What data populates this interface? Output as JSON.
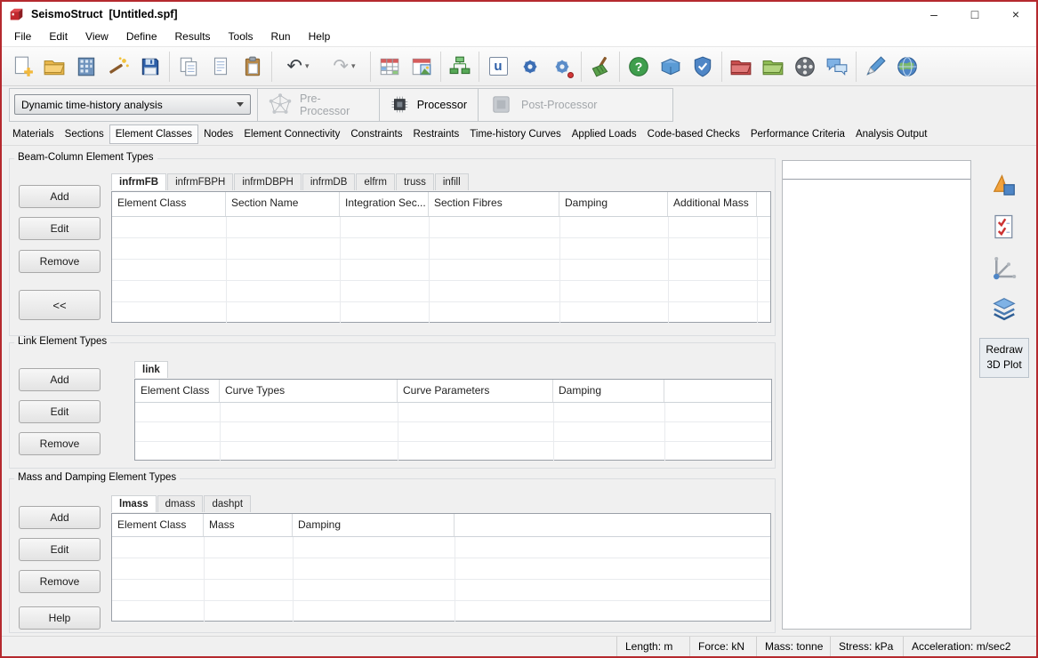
{
  "colors": {
    "brand_red": "#b5292e",
    "panel_gray": "#f0f0f0"
  },
  "window": {
    "title": "SeismoStruct  [Untitled.spf]",
    "controls": {
      "minimize": "–",
      "maximize": "□",
      "close": "×"
    }
  },
  "menubar": {
    "items": [
      "File",
      "Edit",
      "View",
      "Define",
      "Results",
      "Tools",
      "Run",
      "Help"
    ]
  },
  "toolbar": {
    "units_label": "u",
    "glyphs": {
      "undo": "↶",
      "redo": "↷",
      "dropdown": "▾",
      "help_q": "?"
    },
    "icons": [
      "new-project",
      "open-project",
      "building-modeller",
      "wizard",
      "save",
      "copy",
      "duplicate",
      "paste",
      "undo",
      "redo",
      "show-model-table",
      "show-model-image",
      "element-connectivity",
      "units",
      "program-settings",
      "advanced-settings",
      "clean",
      "help",
      "user-manual",
      "technical-support",
      "open-red-folder",
      "open-green-folder",
      "video-tutorials",
      "discussion-forum",
      "seismo-tools",
      "website"
    ]
  },
  "analysis_bar": {
    "analysis_type": "Dynamic time-history analysis",
    "stages": [
      {
        "label": "Pre-Processor",
        "enabled": false
      },
      {
        "label": "Processor",
        "enabled": true
      },
      {
        "label": "Post-Processor",
        "enabled": false
      }
    ]
  },
  "tabbar": {
    "selected": "Element Classes",
    "items": [
      "Materials",
      "Sections",
      "Element Classes",
      "Nodes",
      "Element Connectivity",
      "Constraints",
      "Restraints",
      "Time-history Curves",
      "Applied Loads",
      "Code-based Checks",
      "Performance Criteria",
      "Analysis Output"
    ]
  },
  "beam_column": {
    "title": "Beam-Column Element Types",
    "buttons": {
      "add": "Add",
      "edit": "Edit",
      "remove": "Remove",
      "collapse": "<<"
    },
    "tabs": [
      "infrmFB",
      "infrmFBPH",
      "infrmDBPH",
      "infrmDB",
      "elfrm",
      "truss",
      "infill"
    ],
    "selected_tab": "infrmFB",
    "columns": [
      "Element Class",
      "Section Name",
      "Integration Sec...",
      "Section Fibres",
      "Damping",
      "Additional Mass"
    ],
    "rows": []
  },
  "link": {
    "title": "Link Element Types",
    "buttons": {
      "add": "Add",
      "edit": "Edit",
      "remove": "Remove"
    },
    "tabs": [
      "link"
    ],
    "selected_tab": "link",
    "columns": [
      "Element Class",
      "Curve Types",
      "Curve Parameters",
      "Damping"
    ],
    "rows": []
  },
  "mass_damping": {
    "title": "Mass and Damping Element Types",
    "buttons": {
      "add": "Add",
      "edit": "Edit",
      "remove": "Remove",
      "help": "Help"
    },
    "tabs": [
      "lmass",
      "dmass",
      "dashpt"
    ],
    "selected_tab": "lmass",
    "columns": [
      "Element Class",
      "Mass",
      "Damping"
    ],
    "rows": []
  },
  "right_panel": {
    "icons": [
      "plot-options",
      "performance-check",
      "deformed-shape-axes",
      "layers"
    ],
    "redraw": {
      "line1": "Redraw",
      "line2": "3D Plot"
    }
  },
  "statusbar": {
    "items": [
      "Length: m",
      "Force: kN",
      "Mass: tonne",
      "Stress: kPa",
      "Acceleration: m/sec2"
    ]
  }
}
